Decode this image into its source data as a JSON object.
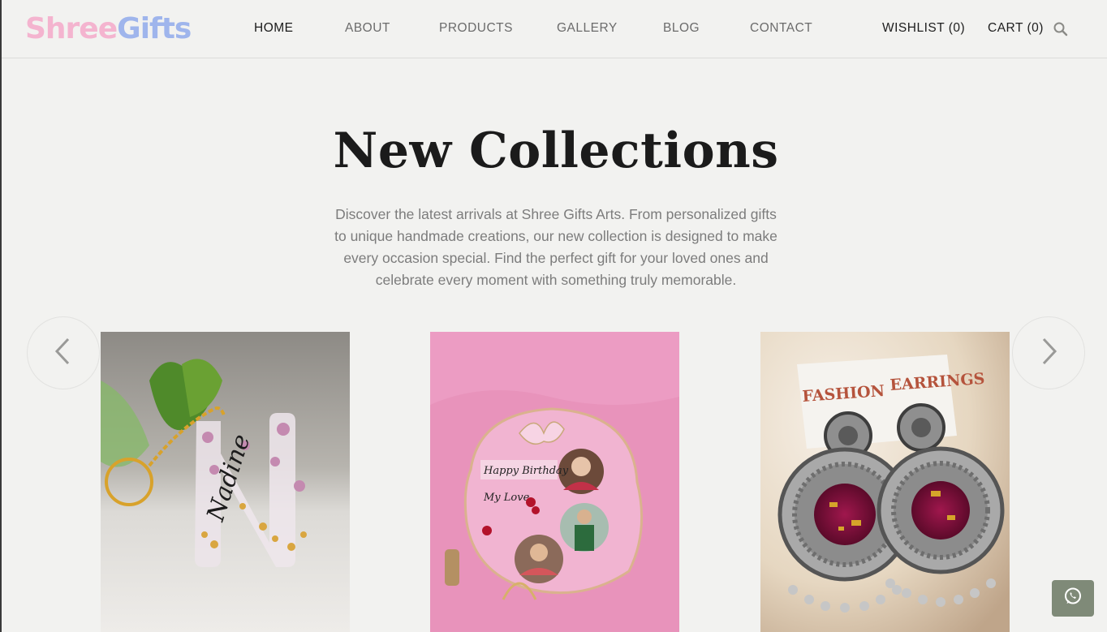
{
  "brand": {
    "part1": "Shree",
    "part2": "Gifts",
    "color1": "#f4b4cf",
    "color2": "#9fb5ec"
  },
  "nav": {
    "home": "HOME",
    "about": "ABOUT",
    "products": "PRODUCTS",
    "gallery": "GALLERY",
    "blog": "BLOG",
    "contact": "CONTACT"
  },
  "header_right": {
    "wishlist": "WISHLIST (0)",
    "cart": "CART (0)",
    "search_icon": "search-icon"
  },
  "hero": {
    "title": "New Collections",
    "description": "Discover the latest arrivals at Shree Gifts Arts. From personalized gifts to unique handmade creations, our new collection is designed to make every occasion special. Find the perfect gift for your loved ones and celebrate every moment with something truly memorable."
  },
  "carousel": {
    "prev_icon": "chevron-left-icon",
    "next_icon": "chevron-right-icon",
    "products": [
      {
        "image": "resin-letter-keychain",
        "signature_text": "Nadine"
      },
      {
        "image": "resin-photo-frame",
        "frame_text_1": "Happy Birthday",
        "frame_text_2": "My Love"
      },
      {
        "image": "resin-earrings",
        "card_text_1": "FASHION",
        "card_text_2": "EARRINGS"
      }
    ]
  },
  "whatsapp": {
    "icon": "whatsapp-icon",
    "color": "#7f8a78"
  }
}
